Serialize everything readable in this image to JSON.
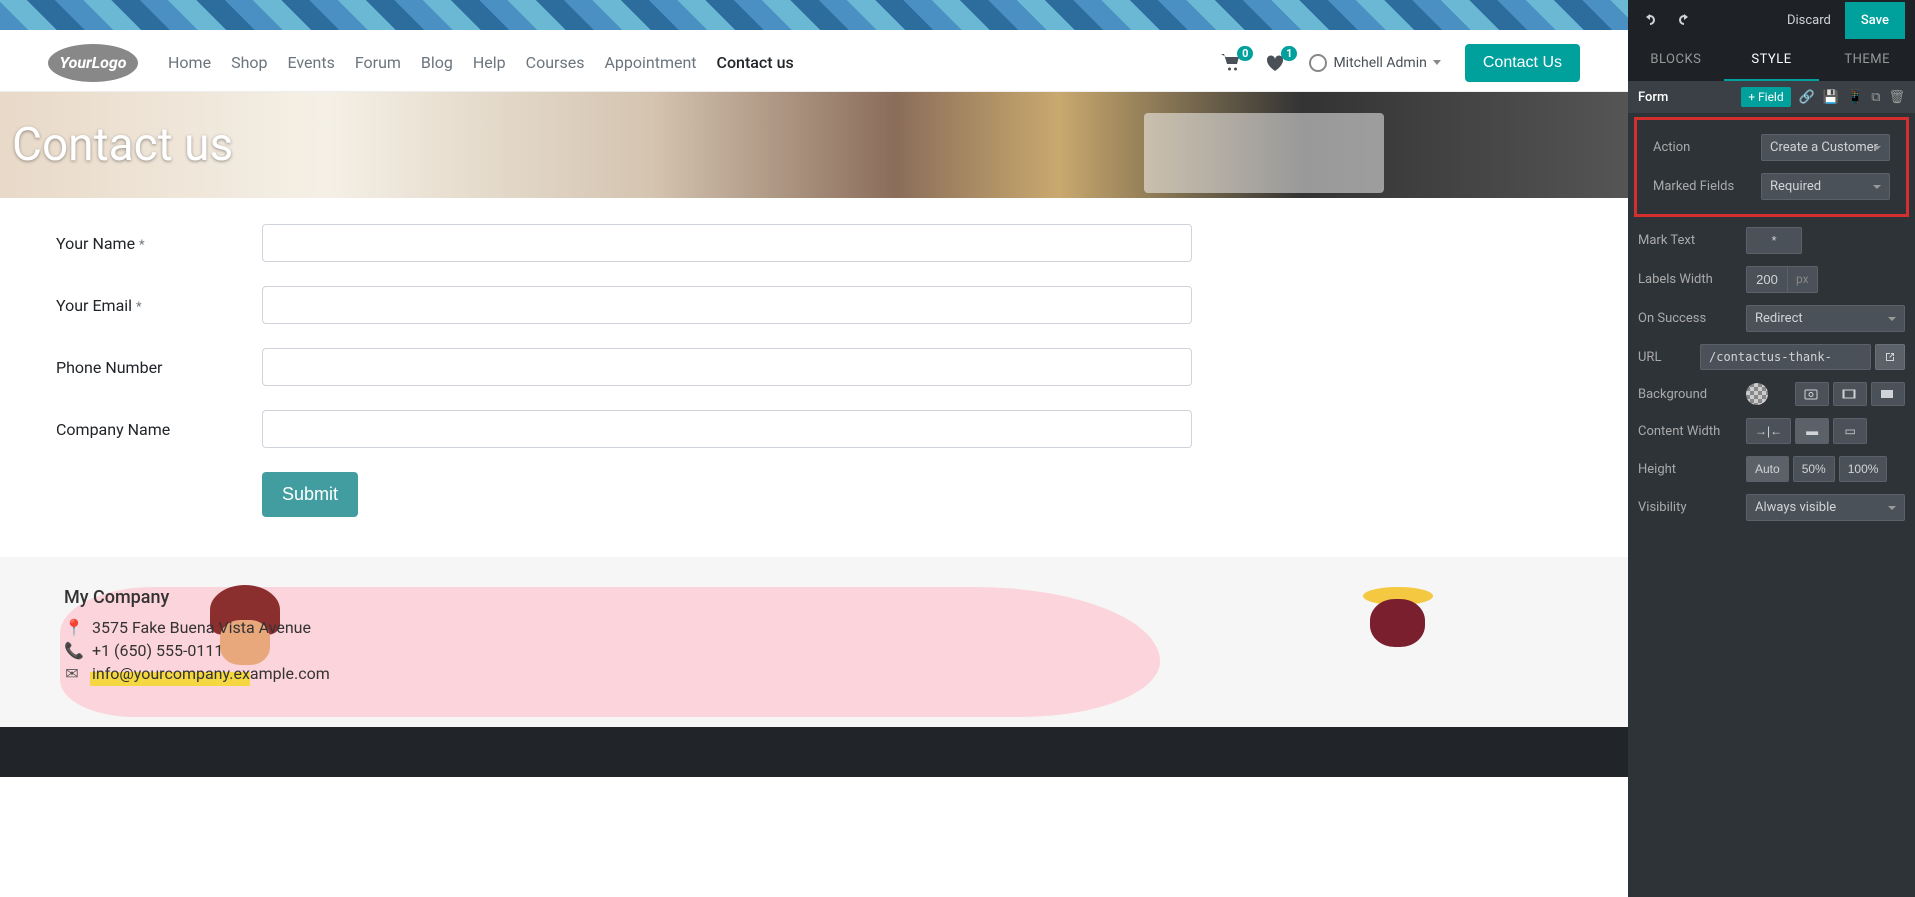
{
  "logo_text": "YourLogo",
  "nav": {
    "items": [
      "Home",
      "Shop",
      "Events",
      "Forum",
      "Blog",
      "Help",
      "Courses",
      "Appointment",
      "Contact us"
    ],
    "active_index": 8
  },
  "cart_count": "0",
  "wishlist_count": "1",
  "user_name": "Mitchell Admin",
  "contact_btn": "Contact Us",
  "banner_title": "Contact us",
  "form": {
    "fields": [
      {
        "label": "Your Name",
        "required": true
      },
      {
        "label": "Your Email",
        "required": true
      },
      {
        "label": "Phone Number",
        "required": false
      },
      {
        "label": "Company Name",
        "required": false
      }
    ],
    "required_marker": "*",
    "submit": "Submit"
  },
  "footer": {
    "company": "My Company",
    "address": "3575 Fake Buena Vista Avenue",
    "phone": "+1 (650) 555-0111",
    "email": "info@yourcompany.example.com"
  },
  "sidebar": {
    "discard": "Discard",
    "save": "Save",
    "tabs": [
      "BLOCKS",
      "STYLE",
      "THEME"
    ],
    "active_tab": 1,
    "section_title": "Form",
    "add_field": "+ Field",
    "rows": {
      "action": {
        "label": "Action",
        "value": "Create a Customer"
      },
      "marked_fields": {
        "label": "Marked Fields",
        "value": "Required"
      },
      "mark_text": {
        "label": "Mark Text",
        "value": "*"
      },
      "labels_width": {
        "label": "Labels Width",
        "value": "200",
        "unit": "px"
      },
      "on_success": {
        "label": "On Success",
        "value": "Redirect"
      },
      "url": {
        "label": "URL",
        "value": "/contactus-thank-"
      },
      "background": {
        "label": "Background"
      },
      "content_width": {
        "label": "Content Width"
      },
      "height": {
        "label": "Height",
        "options": [
          "Auto",
          "50%",
          "100%"
        ],
        "active": 0
      },
      "visibility": {
        "label": "Visibility",
        "value": "Always visible"
      }
    }
  }
}
